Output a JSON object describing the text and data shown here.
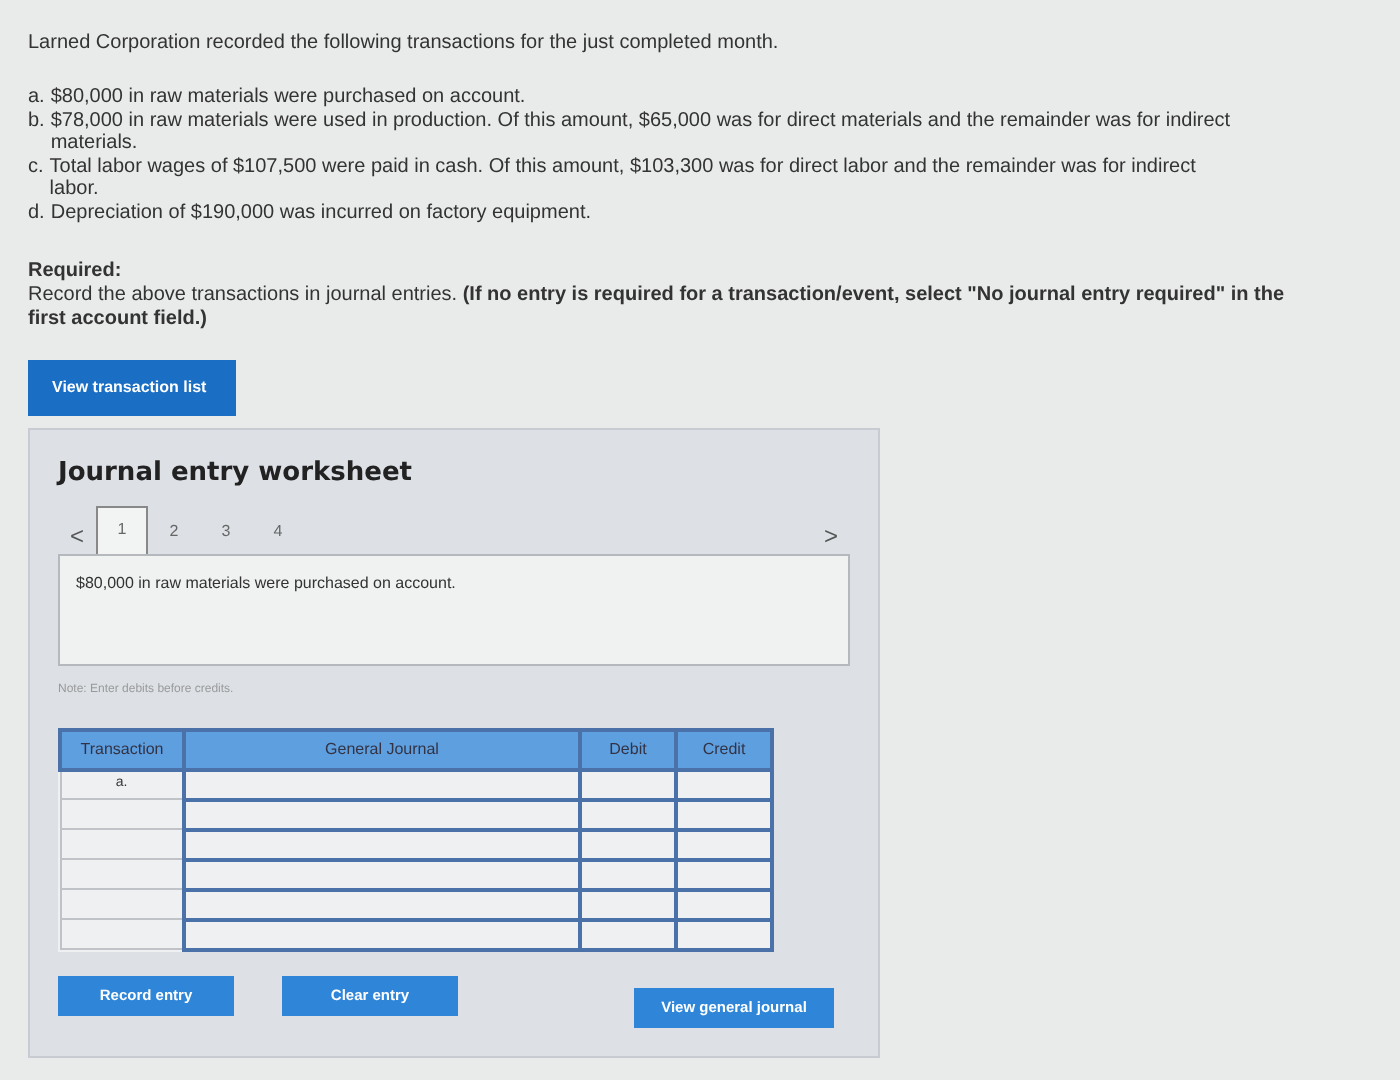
{
  "intro": "Larned Corporation recorded the following transactions for the just completed month.",
  "transactions": [
    {
      "letter": "a.",
      "text": "$80,000 in raw materials were purchased on account."
    },
    {
      "letter": "b.",
      "text": "$78,000 in raw materials were used in production. Of this amount, $65,000 was for direct materials and the remainder was for indirect materials."
    },
    {
      "letter": "c.",
      "text": "Total labor wages of $107,500 were paid in cash. Of this amount, $103,300 was for direct labor and the remainder was for indirect labor."
    },
    {
      "letter": "d.",
      "text": "Depreciation of $190,000 was incurred on factory equipment."
    }
  ],
  "required": {
    "heading": "Required:",
    "text": "Record the above transactions in journal entries. **(If no entry is required for a transaction/event, select \"No journal entry required\" in the first account field.)**"
  },
  "view_transaction_button": "View transaction list",
  "worksheet": {
    "title": "Journal entry worksheet",
    "prev": "<",
    "next": ">",
    "pages": [
      {
        "label": "1",
        "selected": true
      },
      {
        "label": "2",
        "selected": false
      },
      {
        "label": "3",
        "selected": false
      },
      {
        "label": "4",
        "selected": false
      }
    ],
    "description": "$80,000 in raw materials were purchased on account.",
    "note": "Note: Enter debits before credits.",
    "table": {
      "columns": [
        "Transaction",
        "General Journal",
        "Debit",
        "Credit"
      ],
      "rows": [
        {
          "transaction": "a."
        },
        {
          "transaction": ""
        },
        {
          "transaction": ""
        },
        {
          "transaction": ""
        },
        {
          "transaction": ""
        },
        {
          "transaction": ""
        }
      ]
    },
    "buttons": [
      {
        "label": "Record entry",
        "kind": "left"
      },
      {
        "label": "Clear entry",
        "kind": "left"
      },
      {
        "label": "View general journal",
        "kind": "right"
      }
    ]
  }
}
